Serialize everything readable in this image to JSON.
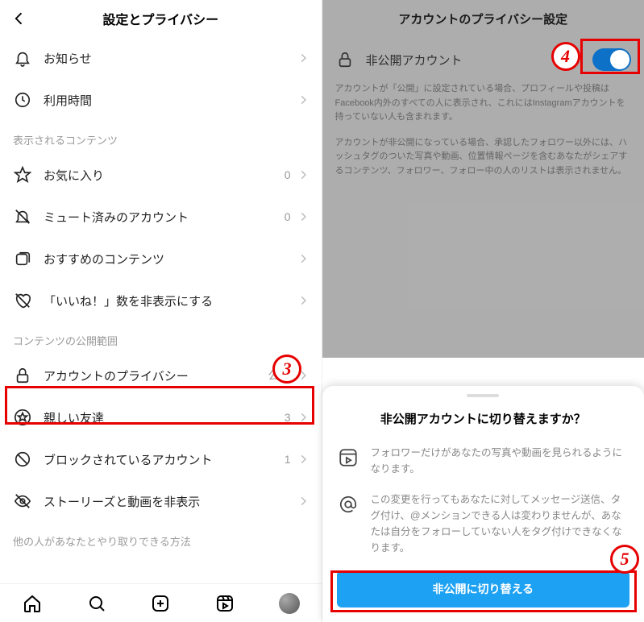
{
  "left": {
    "title": "設定とプライバシー",
    "rows": [
      {
        "key": "notifications",
        "label": "お知らせ",
        "value": ""
      },
      {
        "key": "time",
        "label": "利用時間",
        "value": ""
      }
    ],
    "section1": {
      "title": "表示されるコンテンツ",
      "rows": [
        {
          "key": "favorites",
          "label": "お気に入り",
          "value": "0"
        },
        {
          "key": "muted",
          "label": "ミュート済みのアカウント",
          "value": "0"
        },
        {
          "key": "suggested",
          "label": "おすすめのコンテンツ",
          "value": ""
        },
        {
          "key": "hidelikes",
          "label": "「いいね！」数を非表示にする",
          "value": ""
        }
      ]
    },
    "section2": {
      "title": "コンテンツの公開範囲",
      "rows": [
        {
          "key": "privacy",
          "label": "アカウントのプライバシー",
          "value": "公開"
        },
        {
          "key": "close",
          "label": "親しい友達",
          "value": "3"
        },
        {
          "key": "blocked",
          "label": "ブロックされているアカウント",
          "value": "1"
        },
        {
          "key": "hidestories",
          "label": "ストーリーズと動画を非表示",
          "value": ""
        }
      ]
    },
    "section3": {
      "title": "他の人があなたとやり取りできる方法"
    }
  },
  "right": {
    "title": "アカウントのプライバシー設定",
    "private_label": "非公開アカウント",
    "help1": "アカウントが「公開」に設定されている場合、プロフィールや投稿はFacebook内外のすべての人に表示され、これにはInstagramアカウントを持っていない人も含まれます。",
    "help2": "アカウントが非公開になっている場合、承認したフォロワー以外には、ハッシュタグのついた写真や動画、位置情報ページを含むあなたがシェアするコンテンツ、フォロワー、フォロー中の人のリストは表示されません。",
    "sheet": {
      "title": "非公開アカウントに切り替えますか？",
      "item1": "フォロワーだけがあなたの写真や動画を見られるようになります。",
      "item2": "この変更を行ってもあなたに対してメッセージ送信、タグ付け、@メンションできる人は変わりませんが、あなたは自分をフォローしていない人をタグ付けできなくなります。",
      "cta": "非公開に切り替える"
    }
  },
  "annotations": {
    "a3": "3",
    "a4": "4",
    "a5": "5"
  }
}
